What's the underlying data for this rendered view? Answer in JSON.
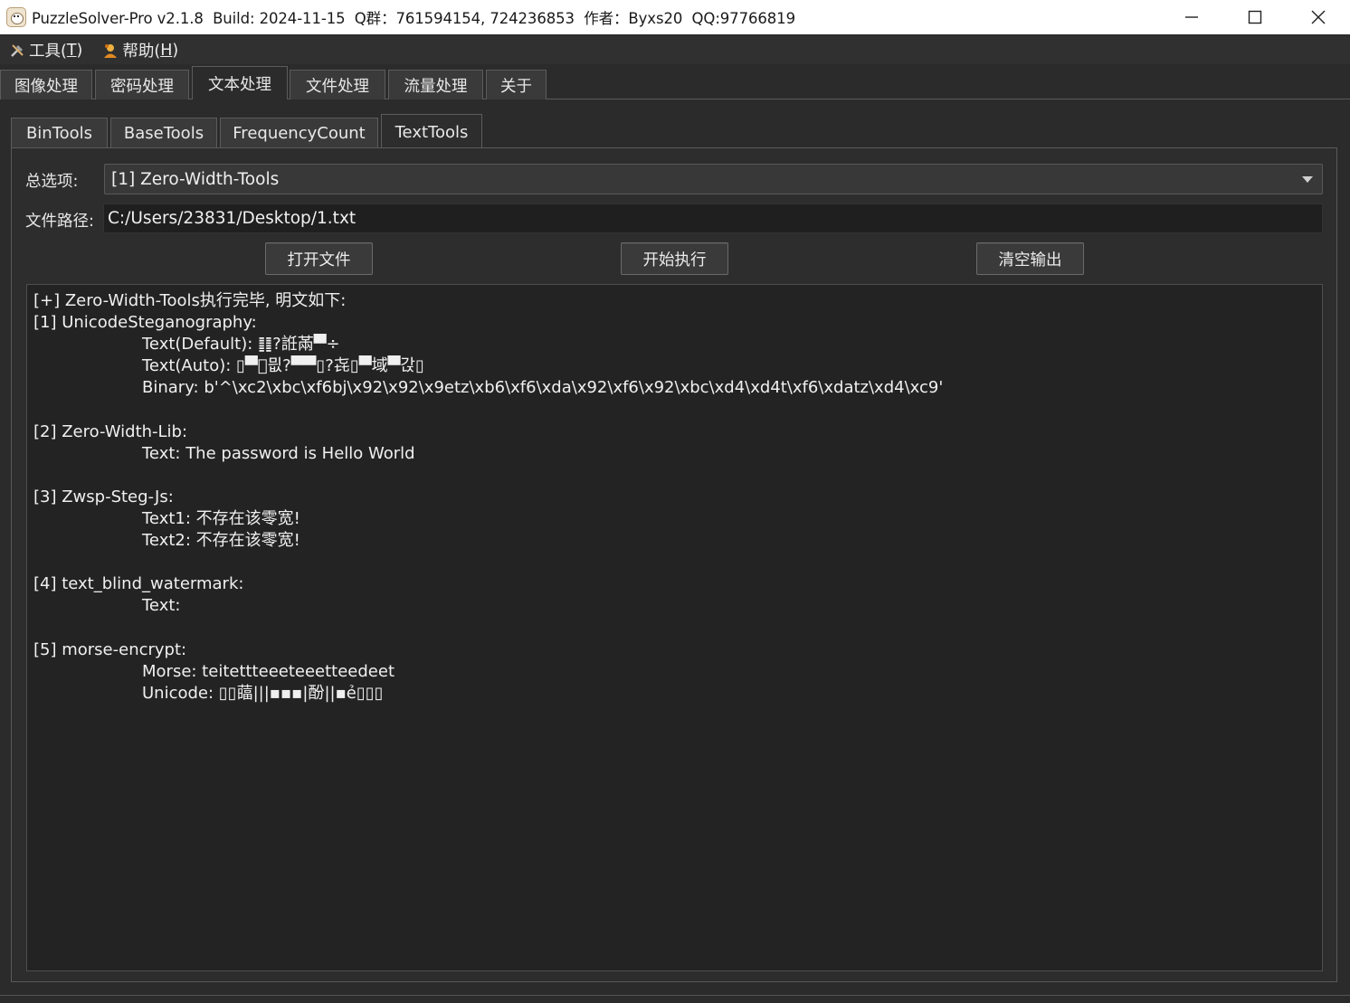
{
  "window": {
    "title": "PuzzleSolver-Pro v2.1.8  Build: 2024-11-15  Q群：761594154, 724236853  作者：Byxs20  QQ:97766819",
    "icon": "puzzle-face-icon"
  },
  "menu": {
    "tools": {
      "label_prefix": "工具(",
      "mnemonic": "T",
      "label_suffix": ")",
      "icon": "tools-icon"
    },
    "help": {
      "label_prefix": "帮助(",
      "mnemonic": "H",
      "label_suffix": ")",
      "icon": "help-person-icon"
    }
  },
  "main_tabs": [
    "图像处理",
    "密码处理",
    "文本处理",
    "文件处理",
    "流量处理",
    "关于"
  ],
  "main_tab_active": "文本处理",
  "sub_tabs": [
    "BinTools",
    "BaseTools",
    "FrequencyCount",
    "TextTools"
  ],
  "sub_tab_active": "TextTools",
  "form": {
    "option_label": "总选项:",
    "option_value": "[1] Zero-Width-Tools",
    "path_label": "文件路径:",
    "path_value": "C:/Users/23831/Desktop/1.txt"
  },
  "buttons": {
    "open": "打开文件",
    "run": "开始执行",
    "clear": "清空输出"
  },
  "output": {
    "lines": [
      {
        "text": "[+] Zero-Width-Tools执行完毕, 明文如下:",
        "indent": false
      },
      {
        "text": "[1] UnicodeSteganography:",
        "indent": false
      },
      {
        "text": "Text(Default): ䷁?䛘㒼▀÷",
        "indent": true
      },
      {
        "text": "Text(Auto): ▯▀᪽믮?▀▀▯?㐂▯▀域▀갅▯",
        "indent": true
      },
      {
        "text": "Binary: b'^\\xc2\\xbc\\xf6bj\\x92\\x92\\x9etz\\xb6\\xf6\\xda\\x92\\xf6\\x92\\xbc\\xd4\\xd4t\\xf6\\xdatz\\xd4\\xc9'",
        "indent": true
      },
      {
        "text": "",
        "indent": false
      },
      {
        "text": "[2] Zero-Width-Lib:",
        "indent": false
      },
      {
        "text": "Text: The password is Hello World",
        "indent": true
      },
      {
        "text": "",
        "indent": false
      },
      {
        "text": "[3] Zwsp-Steg-Js:",
        "indent": false
      },
      {
        "text": "Text1: 不存在该零宽!",
        "indent": true
      },
      {
        "text": "Text2: 不存在该零宽!",
        "indent": true
      },
      {
        "text": "",
        "indent": false
      },
      {
        "text": "[4] text_blind_watermark:",
        "indent": false
      },
      {
        "text": "Text:",
        "indent": true
      },
      {
        "text": "",
        "indent": false
      },
      {
        "text": "[5] morse-encrypt:",
        "indent": false
      },
      {
        "text": "Morse: teitettteeeteeetteedeet",
        "indent": true
      },
      {
        "text": "Unicode: ▯▯䕎|||▪▪▪|酚||▪ẻ▯▯▯",
        "indent": true
      }
    ]
  }
}
